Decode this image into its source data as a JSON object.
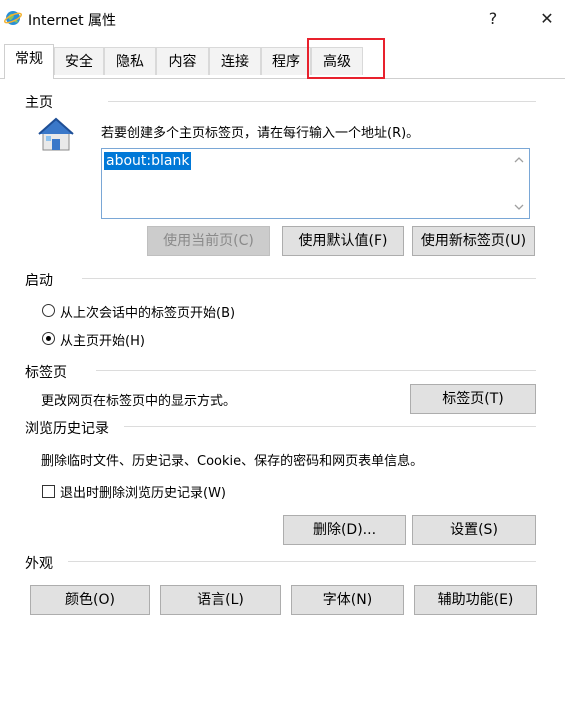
{
  "window": {
    "title": "Internet 属性",
    "help": "?",
    "close": "✕"
  },
  "tabs": [
    "常规",
    "安全",
    "隐私",
    "内容",
    "连接",
    "程序",
    "高级"
  ],
  "home": {
    "heading": "主页",
    "desc": "若要创建多个主页标签页，请在每行输入一个地址(R)。",
    "url": "about:blank",
    "btn_current": "使用当前页(C)",
    "btn_default": "使用默认值(F)",
    "btn_newtab": "使用新标签页(U)"
  },
  "startup": {
    "heading": "启动",
    "opt1": "从上次会话中的标签页开始(B)",
    "opt2": "从主页开始(H)"
  },
  "tabsSection": {
    "heading": "标签页",
    "desc": "更改网页在标签页中的显示方式。",
    "btn": "标签页(T)"
  },
  "history": {
    "heading": "浏览历史记录",
    "desc": "删除临时文件、历史记录、Cookie、保存的密码和网页表单信息。",
    "checkbox": "退出时删除浏览历史记录(W)",
    "btn_delete": "删除(D)...",
    "btn_settings": "设置(S)"
  },
  "appearance": {
    "heading": "外观",
    "btn_colors": "颜色(O)",
    "btn_languages": "语言(L)",
    "btn_fonts": "字体(N)",
    "btn_access": "辅助功能(E)"
  },
  "icons": {
    "app": "ie-globe-icon",
    "home": "house-icon"
  },
  "colors": {
    "highlight_box": "#e8212d",
    "selection": "#0078d7"
  }
}
